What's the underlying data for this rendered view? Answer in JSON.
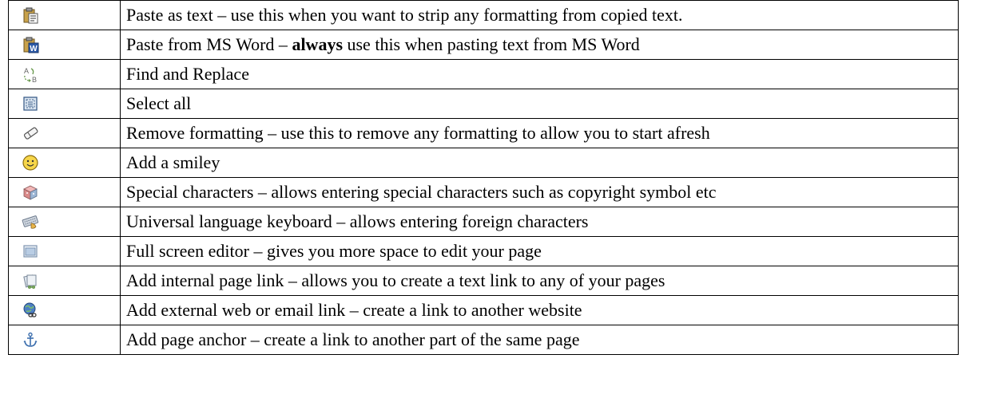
{
  "rows": [
    {
      "icon": "paste-text-icon",
      "parts": [
        {
          "text": "Paste as text – use this when you want to strip any formatting from copied text."
        }
      ]
    },
    {
      "icon": "paste-word-icon",
      "parts": [
        {
          "text": "Paste from MS Word – "
        },
        {
          "text": "always",
          "bold": true
        },
        {
          "text": " use this when pasting text from MS Word"
        }
      ]
    },
    {
      "icon": "find-replace-icon",
      "parts": [
        {
          "text": "Find and Replace"
        }
      ]
    },
    {
      "icon": "select-all-icon",
      "parts": [
        {
          "text": "Select all"
        }
      ]
    },
    {
      "icon": "eraser-icon",
      "parts": [
        {
          "text": "Remove formatting – use this to remove any formatting to allow you to start afresh"
        }
      ]
    },
    {
      "icon": "smiley-icon",
      "parts": [
        {
          "text": "Add a smiley"
        }
      ]
    },
    {
      "icon": "special-characters-icon",
      "parts": [
        {
          "text": "Special characters – allows entering special characters such as copyright symbol etc"
        }
      ]
    },
    {
      "icon": "keyboard-icon",
      "parts": [
        {
          "text": "Universal language keyboard – allows entering foreign characters"
        }
      ]
    },
    {
      "icon": "fullscreen-icon",
      "parts": [
        {
          "text": "Full screen editor – gives you more space to edit your page"
        }
      ]
    },
    {
      "icon": "internal-link-icon",
      "parts": [
        {
          "text": "Add internal page link – allows you to create a text link to any of your pages"
        }
      ]
    },
    {
      "icon": "external-link-icon",
      "parts": [
        {
          "text": "Add external web or email link – create a link to another website"
        }
      ]
    },
    {
      "icon": "anchor-icon",
      "parts": [
        {
          "text": "Add page anchor – create a link to another part of the same page"
        }
      ]
    }
  ]
}
